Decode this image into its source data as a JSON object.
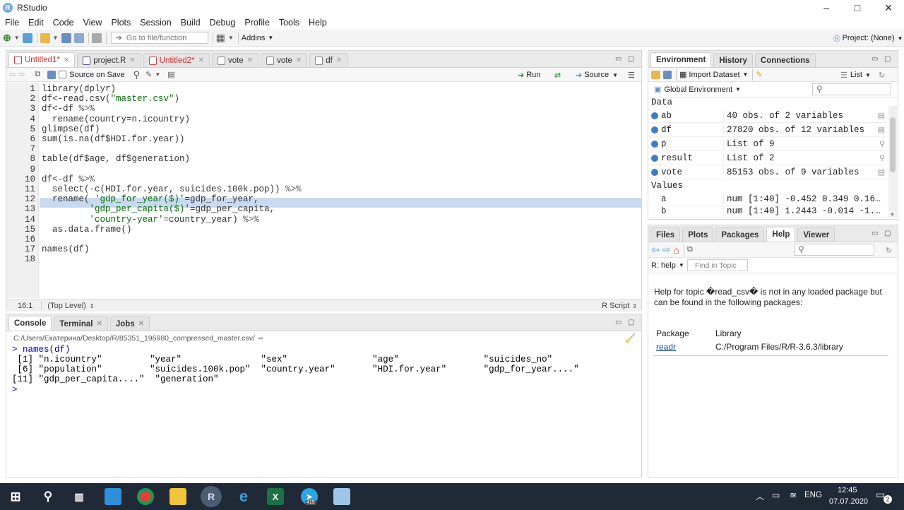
{
  "app": {
    "title": "RStudio",
    "logo_letter": "R"
  },
  "window_controls": {
    "minimize": "‒",
    "maximize": "□",
    "close": "✕"
  },
  "menu": [
    "File",
    "Edit",
    "Code",
    "View",
    "Plots",
    "Session",
    "Build",
    "Debug",
    "Profile",
    "Tools",
    "Help"
  ],
  "toolbar": {
    "goto_placeholder": "Go to file/function",
    "addins": "Addins",
    "project": "Project: (None)"
  },
  "editor": {
    "tabs": [
      "Untitled1*",
      "project.R",
      "Untitled2*",
      "vote",
      "vote",
      "df"
    ],
    "source_on_save": "Source on Save",
    "run": "Run",
    "source": "Source",
    "line_numbers": [
      "1",
      "2",
      "3",
      "4",
      "5",
      "6",
      "7",
      "8",
      "9",
      "10",
      "11",
      "12",
      "13",
      "14",
      "15",
      "16",
      "17",
      "18"
    ],
    "status_pos": "16:1",
    "status_level": "(Top Level)",
    "status_type": "R Script"
  },
  "code": {
    "l1_a": "library(dplyr)",
    "l2_a": "df<-read.csv(",
    "l2_s": "\"master.csv\"",
    "l2_b": ")",
    "l3_a": "df<-df ",
    "l3_o": "%>%",
    "l4_a": "  rename(country=n.icountry)",
    "l5_a": "glimpse(df)",
    "l6_a": "sum(is.na(df$HDI.for.year))",
    "l8_a": "table(df$age, df$generation)",
    "l10_a": "df<-df ",
    "l10_o": "%>%",
    "l11_a": "  select(-c(HDI.for.year, suicides.100k.pop)) ",
    "l11_o": "%>%",
    "l12_a": "  rename( ",
    "l12_s": "'gdp_for_year($)'",
    "l12_b": "=gdp_for_year,",
    "l13_p": "         ",
    "l13_s": "'gdp_per_capita($)'",
    "l13_b": "=gdp_per_capita,",
    "l14_p": "         ",
    "l14_s": "'country-year'",
    "l14_b": "=country_year) ",
    "l14_o": "%>%",
    "l15_a": "  as.data.frame()",
    "l17_a": "names(df)"
  },
  "console": {
    "tabs": [
      "Console",
      "Terminal",
      "Jobs"
    ],
    "path": "C:/Users/Екатерина/Desktop/R/85351_196980_compressed_master.csv/",
    "lines": [
      "> names(df)",
      " [1] \"n.icountry\"         \"year\"               \"sex\"                \"age\"                \"suicides_no\"",
      " [6] \"population\"         \"suicides.100k.pop\"  \"country.year\"       \"HDI.for.year\"       \"gdp_for_year....\"",
      "[11] \"gdp_per_capita....\"  \"generation\"",
      "> "
    ]
  },
  "env": {
    "tabs": [
      "Environment",
      "History",
      "Connections"
    ],
    "import": "Import Dataset",
    "list": "List",
    "scope": "Global Environment",
    "data_header": "Data",
    "values_header": "Values",
    "data": [
      {
        "name": "ab",
        "value": "40 obs. of 2 variables"
      },
      {
        "name": "df",
        "value": "27820 obs. of 12 variables"
      },
      {
        "name": "p",
        "value": "List of 9"
      },
      {
        "name": "result",
        "value": "List of 2"
      },
      {
        "name": "vote",
        "value": "85153 obs. of 9 variables"
      }
    ],
    "values": [
      {
        "name": "a",
        "value": "num [1:40] -0.452 0.349 0.16…"
      },
      {
        "name": "b",
        "value": "num [1:40] 1.2443 -0.014 -1.…"
      }
    ]
  },
  "files": {
    "tabs": [
      "Files",
      "Plots",
      "Packages",
      "Help",
      "Viewer"
    ],
    "rhelp": "R: help",
    "find_placeholder": "Find in Topic",
    "message": "Help for topic �read_csv� is not in any loaded package but can be found in the following packages:",
    "col_package": "Package",
    "col_library": "Library",
    "pkg": "readr",
    "lib": "C:/Program Files/R/R-3.6.3/library"
  },
  "taskbar": {
    "lang": "ENG",
    "time": "12:45",
    "date": "07.07.2020",
    "notif": "2",
    "badge": "415"
  }
}
